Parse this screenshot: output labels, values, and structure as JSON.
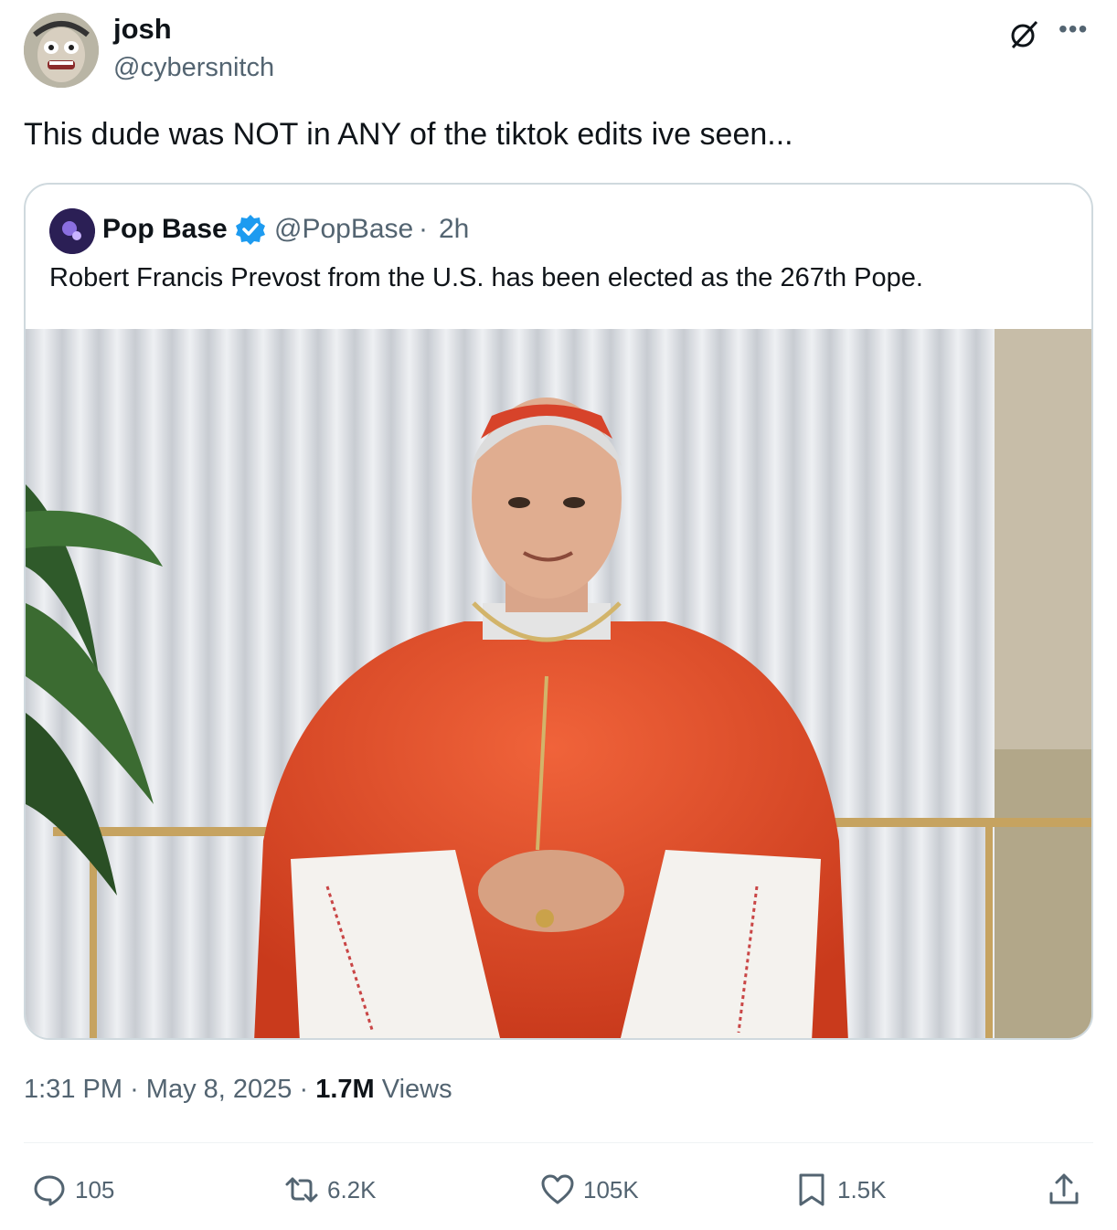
{
  "tweet": {
    "author": {
      "name": "josh",
      "handle": "@cybersnitch"
    },
    "text": "This dude was NOT in ANY of the tiktok edits ive seen...",
    "quoted": {
      "name": "Pop Base",
      "handle": "@PopBase",
      "separator": "·",
      "time": "2h",
      "text": "Robert Francis Prevost from the U.S. has been elected as the 267th Pope."
    },
    "meta": {
      "time": "1:31 PM",
      "sep1": "·",
      "date": "May 8, 2025",
      "sep2": "·",
      "views_count": "1.7M",
      "views_label": "Views"
    },
    "actions": {
      "replies": "105",
      "reposts": "6.2K",
      "likes": "105K",
      "bookmarks": "1.5K"
    }
  },
  "icons": {
    "grok": "grok-icon",
    "more": "more-icon",
    "verified": "verified-badge-icon",
    "reply": "reply-icon",
    "repost": "repost-icon",
    "like": "heart-icon",
    "bookmark": "bookmark-icon",
    "share": "share-icon"
  },
  "colors": {
    "text_primary": "#0f1419",
    "text_secondary": "#536471",
    "verified_blue": "#1d9bf0",
    "border": "#cfd9de"
  }
}
